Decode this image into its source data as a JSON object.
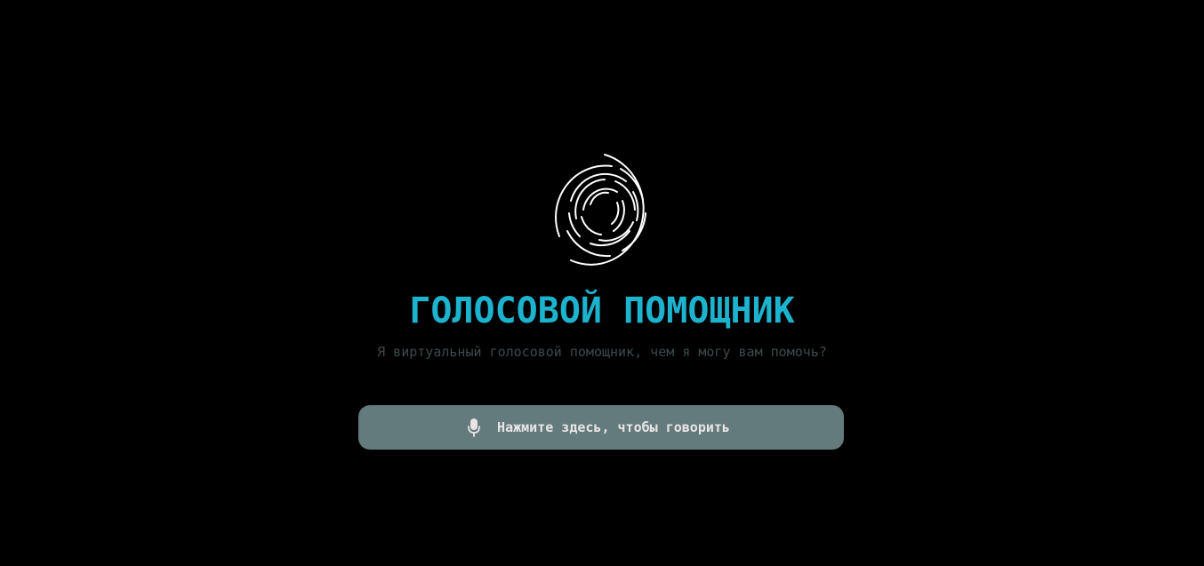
{
  "app": {
    "title": "ГОЛОСОВОЙ ПОМОЩНИК",
    "subtitle": "Я виртуальный голосовой помощник, чем я могу вам помочь?",
    "logo_icon": "concentric-arcs-logo-icon"
  },
  "talk_button": {
    "label": "Нажмите здесь, чтобы говорить",
    "icon": "microphone-icon"
  },
  "colors": {
    "background": "#000000",
    "title": "#1cb3cf",
    "subtitle": "#3b4a4c",
    "button_bg": "#637b7d",
    "button_text": "#e9e4e4",
    "logo_stroke": "#ffffff"
  }
}
